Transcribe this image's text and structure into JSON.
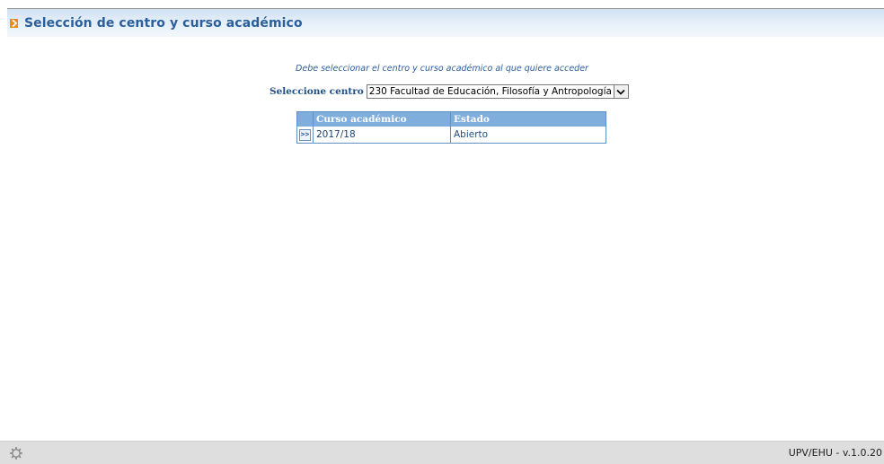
{
  "header": {
    "title": "Selección de centro y curso académico",
    "icon": "orange-arrow-icon"
  },
  "instruction": "Debe seleccionar el centro y curso académico al que quiere acceder",
  "centro": {
    "label": "Seleccione centro",
    "selected": "230 Facultad de Educación, Filosofía y Antropología"
  },
  "table": {
    "headers": [
      "",
      "Curso académico",
      "Estado"
    ],
    "rows": [
      {
        "action": ">>",
        "curso": "2017/18",
        "estado": "Abierto"
      }
    ]
  },
  "footer": {
    "icon": "gear-icon",
    "version": "UPV/EHU - v.1.0.20"
  },
  "colors": {
    "header_title": "#2a5f9c",
    "accent_arrow": "#f08a1c",
    "table_header_bg": "#7faedd",
    "table_border": "#5f8fc4",
    "footer_bg": "#dedede"
  }
}
